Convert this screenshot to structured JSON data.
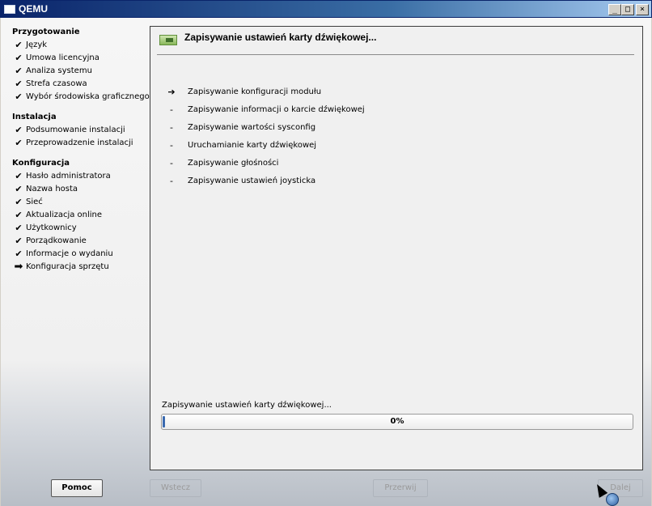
{
  "window": {
    "title": "QEMU",
    "min_label": "_",
    "max_label": "□",
    "close_label": "×"
  },
  "sidebar": {
    "sections": [
      {
        "title": "Przygotowanie",
        "steps": [
          {
            "label": "Język",
            "state": "done"
          },
          {
            "label": "Umowa licencyjna",
            "state": "done"
          },
          {
            "label": "Analiza systemu",
            "state": "done"
          },
          {
            "label": "Strefa czasowa",
            "state": "done"
          },
          {
            "label": "Wybór środowiska graficznego",
            "state": "done"
          }
        ]
      },
      {
        "title": "Instalacja",
        "steps": [
          {
            "label": "Podsumowanie instalacji",
            "state": "done"
          },
          {
            "label": "Przeprowadzenie instalacji",
            "state": "done"
          }
        ]
      },
      {
        "title": "Konfiguracja",
        "steps": [
          {
            "label": "Hasło administratora",
            "state": "done"
          },
          {
            "label": "Nazwa hosta",
            "state": "done"
          },
          {
            "label": "Sieć",
            "state": "done"
          },
          {
            "label": "Aktualizacja online",
            "state": "done"
          },
          {
            "label": "Użytkownicy",
            "state": "done"
          },
          {
            "label": "Porządkowanie",
            "state": "done"
          },
          {
            "label": "Informacje o wydaniu",
            "state": "done"
          },
          {
            "label": "Konfiguracja sprzętu",
            "state": "current"
          }
        ]
      }
    ],
    "done_mark": "✔",
    "current_mark": "➡"
  },
  "panel": {
    "title": "Zapisywanie ustawień karty dźwiękowej...",
    "tasks": [
      {
        "mark": "➔",
        "label": "Zapisywanie konfiguracji modułu"
      },
      {
        "mark": "-",
        "label": "Zapisywanie informacji o karcie dźwiękowej"
      },
      {
        "mark": "-",
        "label": "Zapisywanie wartości sysconfig"
      },
      {
        "mark": "-",
        "label": "Uruchamianie karty dźwiękowej"
      },
      {
        "mark": "-",
        "label": "Zapisywanie głośności"
      },
      {
        "mark": "-",
        "label": "Zapisywanie ustawień joysticka"
      }
    ],
    "progress": {
      "label": "Zapisywanie ustawień karty dźwiękowej...",
      "percent": 0,
      "text": "0%"
    }
  },
  "buttons": {
    "help": "Pomoc",
    "back": "Wstecz",
    "abort": "Przerwij",
    "next": "Dalej"
  },
  "colors": {
    "accent": "#3a6ab0",
    "titlebar": "#0a246a"
  }
}
